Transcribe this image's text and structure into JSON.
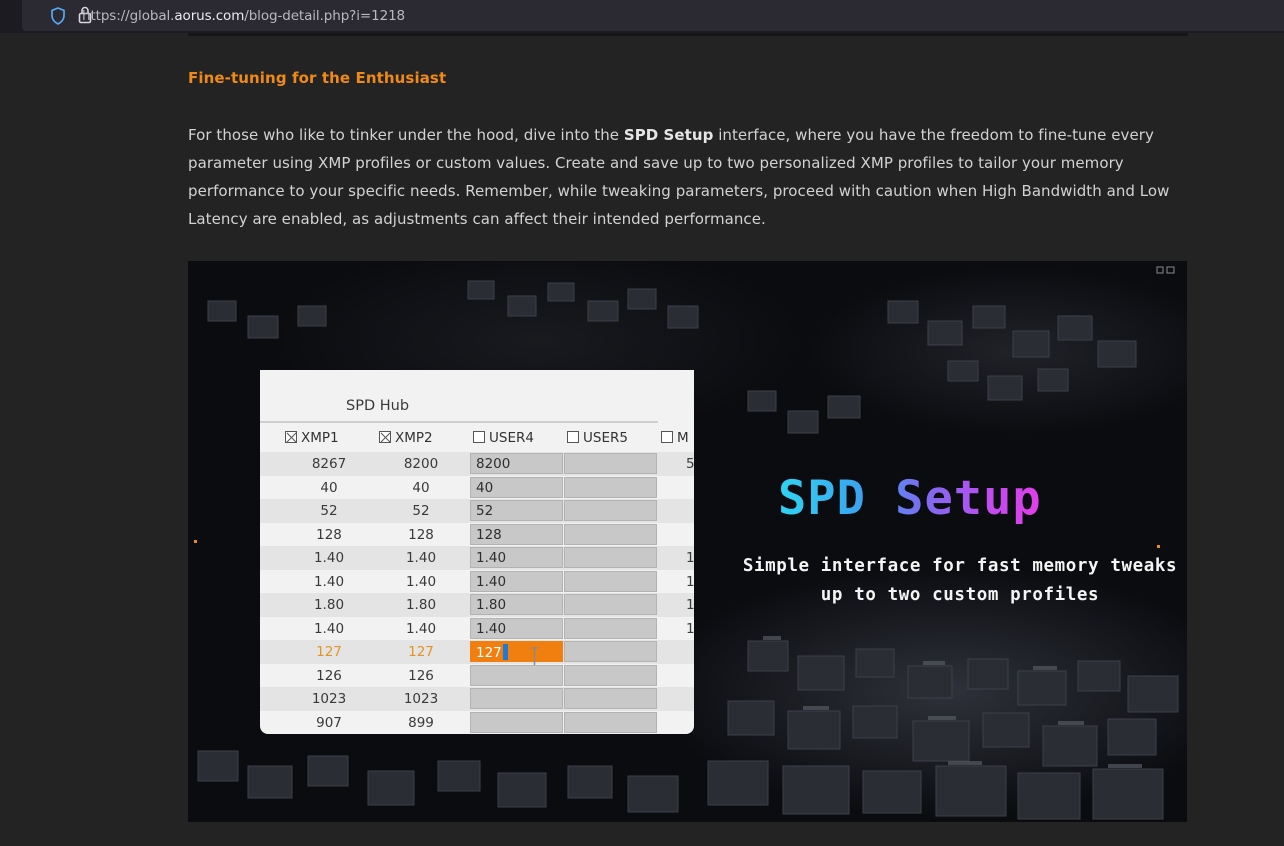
{
  "browser": {
    "url_prefix": "https://global.",
    "url_domain": "aorus.com",
    "url_path": "/blog-detail.php?i=1218"
  },
  "article": {
    "heading": "Fine-tuning for the Enthusiast",
    "para_part1": "For those who like to tinker under the hood, dive into the ",
    "para_bold": "SPD Setup",
    "para_part2": " interface, where you have the freedom to fine-tune every parameter using XMP profiles or custom values. Create and save up to two personalized XMP profiles to tailor your memory performance to your specific needs. Remember, while tweaking parameters, proceed with caution when High Bandwidth and Low Latency are enabled, as adjustments can affect their intended performance."
  },
  "banner": {
    "title": "SPD Setup",
    "subtitle_line1": "Simple interface for fast memory tweaks",
    "subtitle_line2": "up to two custom profiles"
  },
  "hub": {
    "title": "SPD Hub",
    "columns": [
      "XMP1",
      "XMP2",
      "USER4",
      "USER5",
      "M"
    ],
    "column_checked": [
      true,
      true,
      false,
      false,
      false
    ],
    "rows": [
      {
        "xmp1": "8267",
        "xmp2": "8200",
        "user4": "8200",
        "user5": "",
        "m": "5"
      },
      {
        "xmp1": "40",
        "xmp2": "40",
        "user4": "40",
        "user5": "",
        "m": ""
      },
      {
        "xmp1": "52",
        "xmp2": "52",
        "user4": "52",
        "user5": "",
        "m": ""
      },
      {
        "xmp1": "128",
        "xmp2": "128",
        "user4": "128",
        "user5": "",
        "m": ""
      },
      {
        "xmp1": "1.40",
        "xmp2": "1.40",
        "user4": "1.40",
        "user5": "",
        "m": "1"
      },
      {
        "xmp1": "1.40",
        "xmp2": "1.40",
        "user4": "1.40",
        "user5": "",
        "m": "1"
      },
      {
        "xmp1": "1.80",
        "xmp2": "1.80",
        "user4": "1.80",
        "user5": "",
        "m": "1"
      },
      {
        "xmp1": "1.40",
        "xmp2": "1.40",
        "user4": "1.40",
        "user5": "",
        "m": "1"
      },
      {
        "xmp1": "127",
        "xmp2": "127",
        "user4": "127",
        "user5": "",
        "m": "",
        "highlight": true
      },
      {
        "xmp1": "126",
        "xmp2": "126",
        "user4": "",
        "user5": "",
        "m": ""
      },
      {
        "xmp1": "1023",
        "xmp2": "1023",
        "user4": "",
        "user5": "",
        "m": ""
      },
      {
        "xmp1": "907",
        "xmp2": "899",
        "user4": "",
        "user5": "",
        "m": ""
      }
    ]
  },
  "colors": {
    "accent": "#f08a16",
    "background": "#232323",
    "text": "#d2d2d2",
    "highlight_cell": "#f07f10",
    "title_gradient_start": "#2fd4f2",
    "title_gradient_end": "#e23ee8"
  }
}
